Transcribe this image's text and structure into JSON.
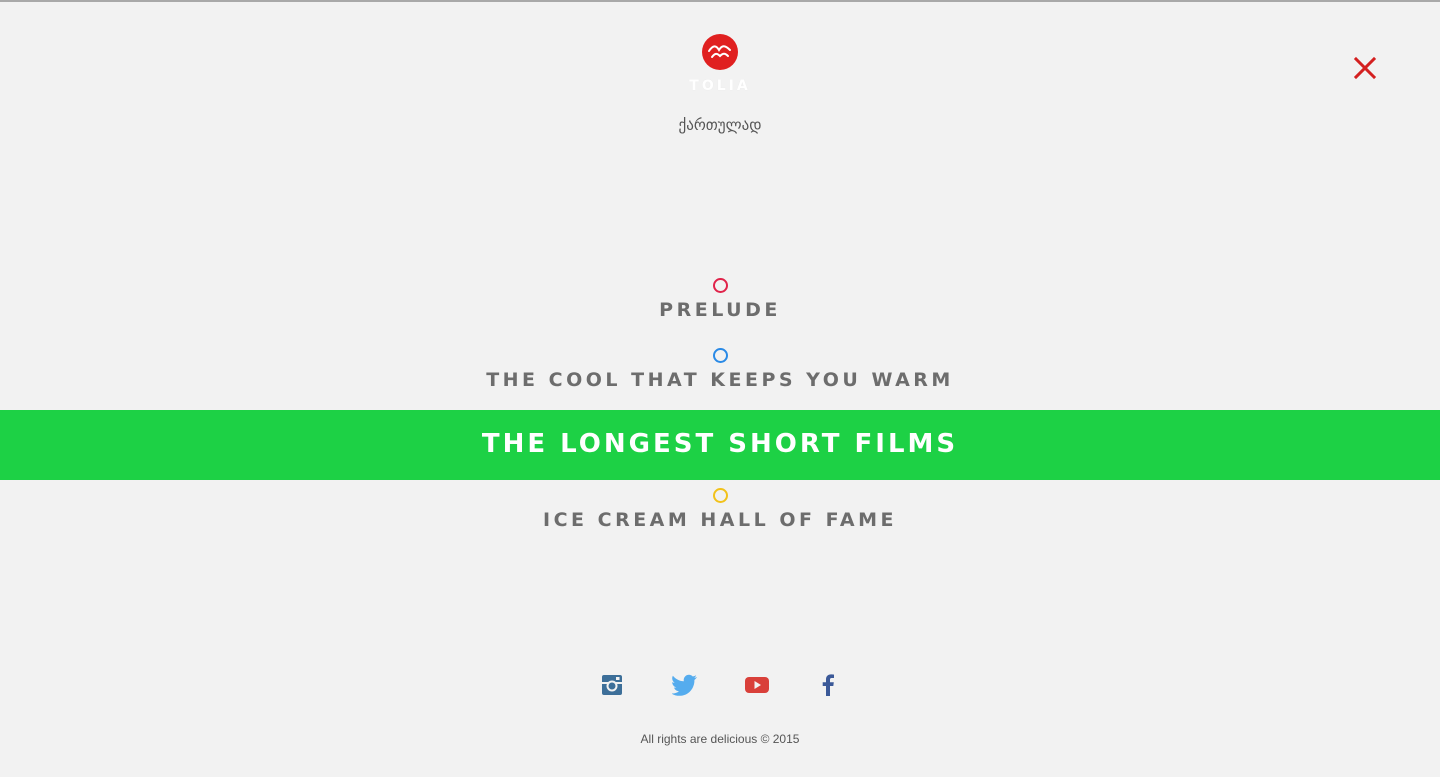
{
  "brand": {
    "name": "TOLIA",
    "logo_color": "#e02020"
  },
  "language_link": "ქართულად",
  "close": {
    "icon": "close-icon",
    "color": "#d42020"
  },
  "menu": {
    "items": [
      {
        "label": "PRELUDE",
        "dot_color": "#e0234a",
        "active": false
      },
      {
        "label": "THE COOL THAT KEEPS YOU WARM",
        "dot_color": "#2a8ae6",
        "active": false
      },
      {
        "label": "THE LONGEST SHORT FILMS",
        "dot_color": "#1dd145",
        "active": true
      },
      {
        "label": "ICE CREAM HALL OF FAME",
        "dot_color": "#f2c21b",
        "active": false
      }
    ],
    "active_bg": "#1dd145"
  },
  "social": [
    {
      "name": "instagram-icon",
      "color": "#3d6f99"
    },
    {
      "name": "twitter-icon",
      "color": "#55acee"
    },
    {
      "name": "youtube-icon",
      "color": "#d9403a"
    },
    {
      "name": "facebook-icon",
      "color": "#3b5998"
    }
  ],
  "footer": {
    "text": "All rights are delicious © 2015"
  }
}
